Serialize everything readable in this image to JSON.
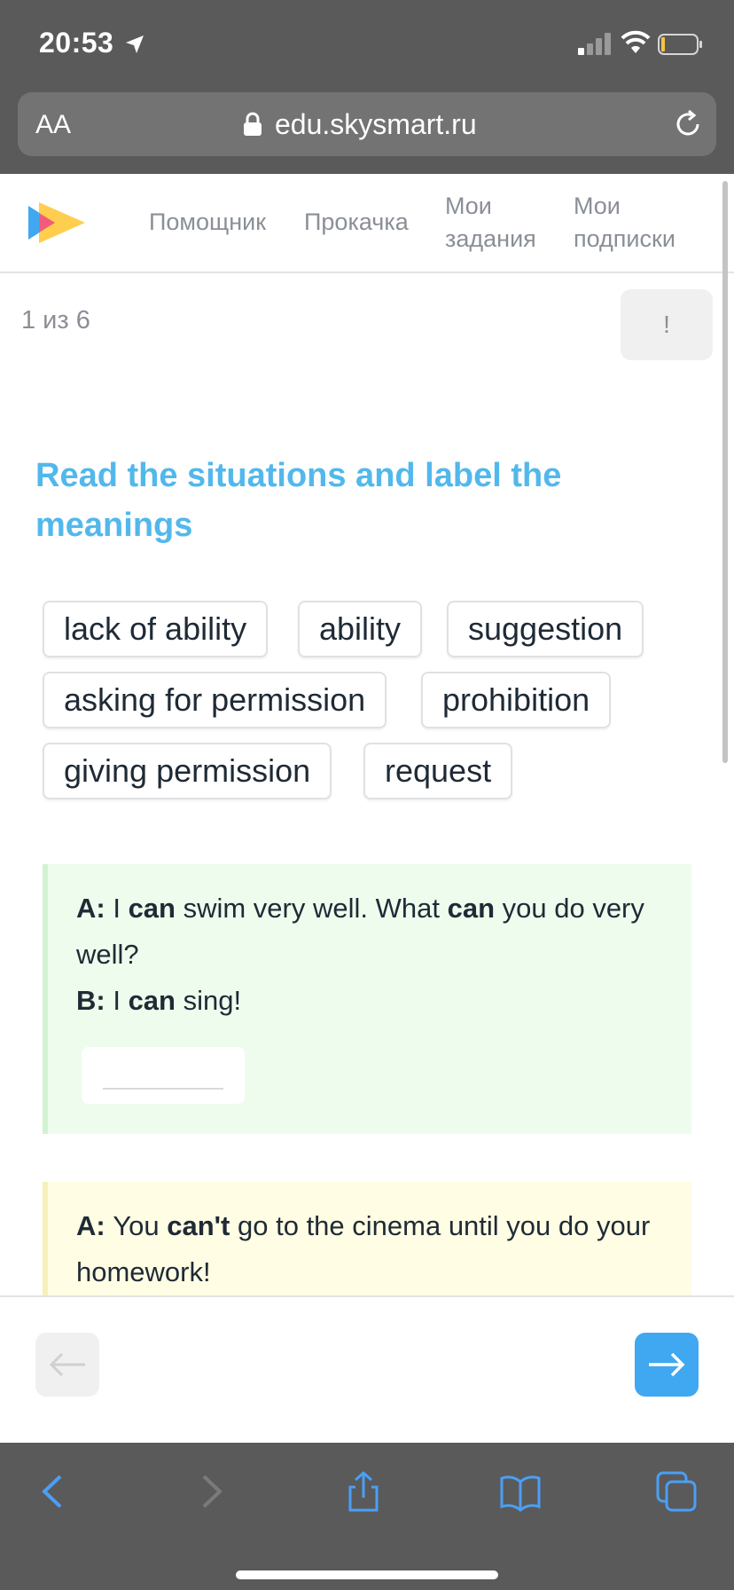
{
  "status_bar": {
    "time": "20:53"
  },
  "browser": {
    "text_size_label": "AA",
    "url": "edu.skysmart.ru"
  },
  "site": {
    "nav": [
      "Помощник",
      "Прокачка",
      "Мои задания",
      "Мои подписки"
    ],
    "nav_lines": [
      [
        "Помощник"
      ],
      [
        "Прокачка"
      ],
      [
        "Мои",
        "задания"
      ],
      [
        "Мои",
        "подписки"
      ]
    ]
  },
  "task": {
    "counter": "1 из 6",
    "report_label": "!",
    "title": "Read the situations and label the meanings",
    "options": [
      "lack of ability",
      "ability",
      "suggestion",
      "asking for permission",
      "prohibition",
      "giving permission",
      "request"
    ]
  },
  "situations": [
    {
      "bg_color": "#eefced",
      "line1": {
        "speaker": "A:",
        "parts": [
          "I ",
          "can",
          " swim very well. What ",
          "can",
          " you do very well?"
        ]
      },
      "line2": {
        "speaker": "B:",
        "parts": [
          "I ",
          "can",
          " sing!"
        ]
      },
      "answer": ""
    },
    {
      "bg_color": "#fffde3",
      "line1": {
        "speaker": "A:",
        "parts": [
          "You ",
          "can't",
          " go to the cinema until you do your homework!"
        ]
      }
    }
  ],
  "colors": {
    "accent": "#52b8ec",
    "next_button": "#3fa8f0"
  }
}
